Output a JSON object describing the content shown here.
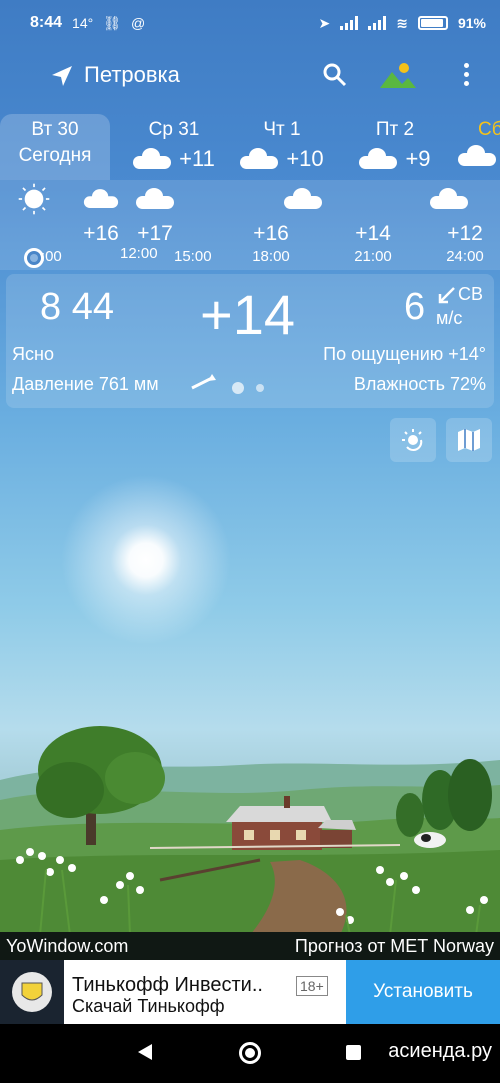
{
  "status_bar": {
    "time": "8:44",
    "temp": "14°",
    "battery": "91%"
  },
  "header": {
    "location": "Петровка"
  },
  "days": [
    {
      "name": "Вт 30",
      "sub": "Сегодня",
      "temp": ""
    },
    {
      "name": "Ср 31",
      "temp": "+11"
    },
    {
      "name": "Чт 1",
      "temp": "+10"
    },
    {
      "name": "Пт 2",
      "temp": "+9"
    },
    {
      "name": "Сб",
      "temp": ""
    }
  ],
  "hourly": [
    {
      "time": "10:00",
      "temp": "",
      "icon": "sun-icon"
    },
    {
      "time": "12:00",
      "temp": "+16",
      "icon": "partly-cloudy-icon"
    },
    {
      "time": "15:00",
      "temp": "+17",
      "icon": "cloud-icon"
    },
    {
      "time": "18:00",
      "temp": "+16",
      "icon": ""
    },
    {
      "time": "21:00",
      "temp": "+14",
      "icon": "cloud-icon"
    },
    {
      "time": "24:00",
      "temp": "+12",
      "icon": "cloud-icon"
    }
  ],
  "current": {
    "time": "8 44",
    "temp": "+14",
    "wind_speed": "6",
    "wind_dir": "СВ",
    "wind_unit": "м/с",
    "condition": "Ясно",
    "feels_like": "По ощущению +14°",
    "pressure": "Давление 761 мм",
    "humidity": "Влажность 72%"
  },
  "credits": {
    "left": "YoWindow.com",
    "right": "Прогноз от MET Norway"
  },
  "ad": {
    "title": "Тинькофф Инвести..",
    "age": "18+",
    "subtitle": "Скачай Тинькофф",
    "button": "Установить"
  },
  "watermark": "асиенда.ру",
  "colors": {
    "sky_top": "#3f7cc4",
    "ad_button": "#2f9ee8",
    "grass": "#5a9a3a"
  }
}
